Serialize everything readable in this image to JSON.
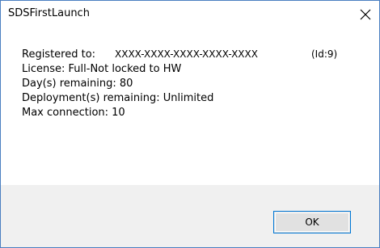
{
  "window": {
    "title": "SDSFirstLaunch",
    "close_icon": "close-icon"
  },
  "info": {
    "registered_label": "Registered to:",
    "registered_value": "XXXX-XXXX-XXXX-XXXX-XXXX",
    "registered_id": "(Id:9)",
    "license": "License: Full-Not locked to HW",
    "days_remaining": "Day(s) remaining: 80",
    "deployments_remaining": "Deployment(s) remaining: Unlimited",
    "max_connection": "Max connection: 10"
  },
  "buttons": {
    "ok_label": "OK"
  },
  "colors": {
    "window_border": "#4a7fc1",
    "footer_bg": "#f0f0f0",
    "button_border": "#0078d7",
    "button_bg": "#e1e1e1"
  }
}
